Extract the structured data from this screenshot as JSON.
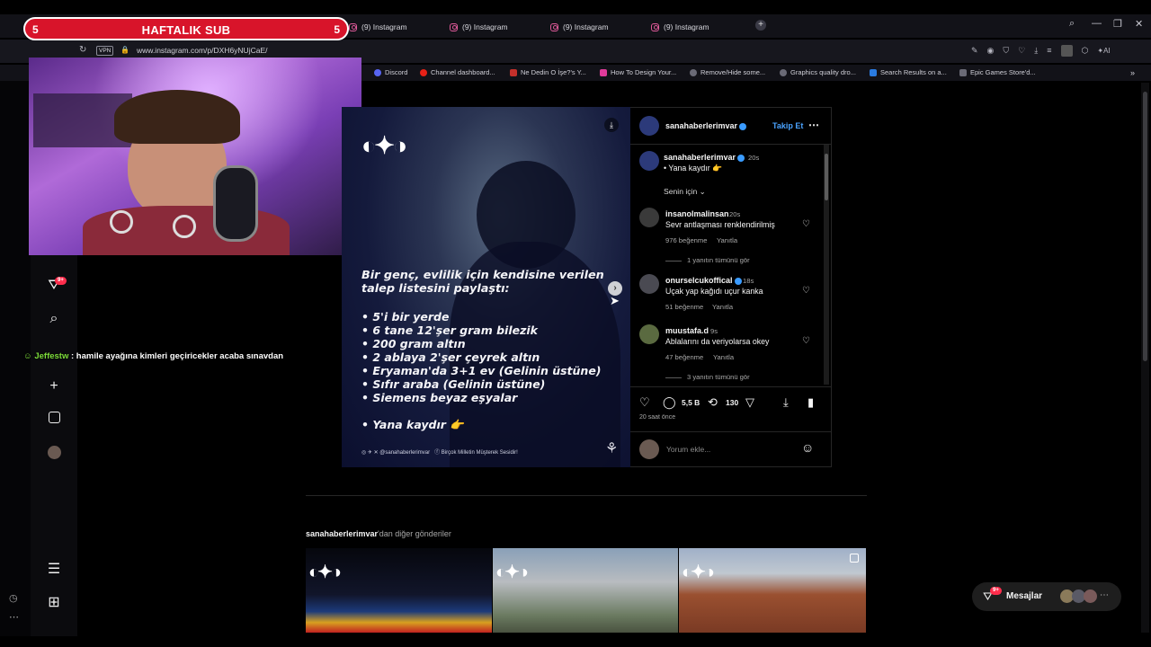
{
  "browser": {
    "tabs": [
      {
        "label": "(9) Instagram"
      },
      {
        "label": "(9) Instagram"
      },
      {
        "label": "(9) Instagram"
      },
      {
        "label": "(9) Instagram"
      }
    ],
    "vpn_label": "VPN",
    "url": "www.instagram.com/p/DXH6yNUjCaE/",
    "ai_label": "AI",
    "bookmarks": [
      {
        "label": "Discord",
        "color": "#5865f2"
      },
      {
        "label": "Channel dashboard...",
        "color": "#e62117"
      },
      {
        "label": "Ne Dedin O İşe?'s Y...",
        "color": "#c4302b"
      },
      {
        "label": "How To Design Your...",
        "color": "#e03a9a"
      },
      {
        "label": "Remove/Hide some...",
        "color": "#8a8a96"
      },
      {
        "label": "Graphics quality dro...",
        "color": "#8a8a96"
      },
      {
        "label": "Search Results on a...",
        "color": "#2a7be0"
      },
      {
        "label": "Epic Games Store'd...",
        "color": "#8a8a96"
      }
    ]
  },
  "overlay": {
    "sub_title": "HAFTALIK SUB",
    "sub_left": "5",
    "sub_right": "5",
    "chat_user": "Jeffestw",
    "chat_message": ": hamile ayağına kimleri geçiricekler acaba sınavdan"
  },
  "sidebar": {
    "notification_badge": "9+"
  },
  "post": {
    "headline_1": "Bir genç, evlilik için kendisine verilen",
    "headline_2": "talep listesini paylaştı:",
    "list": [
      "• 5'i bir yerde",
      "• 6 tane 12'şer gram bilezik",
      "• 200 gram altın",
      "• 2 ablaya 2'şer çeyrek altın",
      "• Eryaman'da 3+1 ev (Gelinin üstüne)",
      "• Sıfır araba (Gelinin üstüne)",
      "• Siemens beyaz eşyalar"
    ],
    "closing": "• Yana kaydır 👉",
    "footer_handle": "@sanahaberlerimvar",
    "footer_right": "Birçok Milletin Müşterek Sesidir!"
  },
  "panel": {
    "account": "sanahaberlerimvar",
    "follow": "Takip Et",
    "caption_user": "sanahaberlerimvar",
    "caption_time": "20s",
    "caption_text": "• Yana kaydır 👉",
    "sort_label": "Senin için",
    "comments": [
      {
        "user": "insanolmalinsan",
        "time": "20s",
        "verified": false,
        "text": "Sevr antlaşması renklendirilmiş",
        "likes": "976 beğenme",
        "reply": "Yanıtla",
        "replies": "1 yanıtın tümünü gör",
        "avatar": "#3a3a3a"
      },
      {
        "user": "onurselcukoffical",
        "time": "18s",
        "verified": true,
        "text": "Uçak yap kağıdı uçur kanka",
        "likes": "51 beğenme",
        "reply": "Yanıtla",
        "replies": "",
        "avatar": "#4a4a52"
      },
      {
        "user": "muustafa.d",
        "time": "9s",
        "verified": false,
        "text": "Ablalarını da veriyolarsa okey",
        "likes": "47 beğenme",
        "reply": "Yanıtla",
        "replies": "3 yanıtın tümünü gör",
        "avatar": "#5a6a40"
      }
    ],
    "comment_count": "5,5 B",
    "repost_count": "130",
    "time_ago": "20 saat önce",
    "comment_placeholder": "Yorum ekle..."
  },
  "more_posts": {
    "user": "sanahaberlerimvar",
    "suffix": "'dan diğer gönderiler"
  },
  "messages": {
    "label": "Mesajlar",
    "badge": "9+"
  }
}
